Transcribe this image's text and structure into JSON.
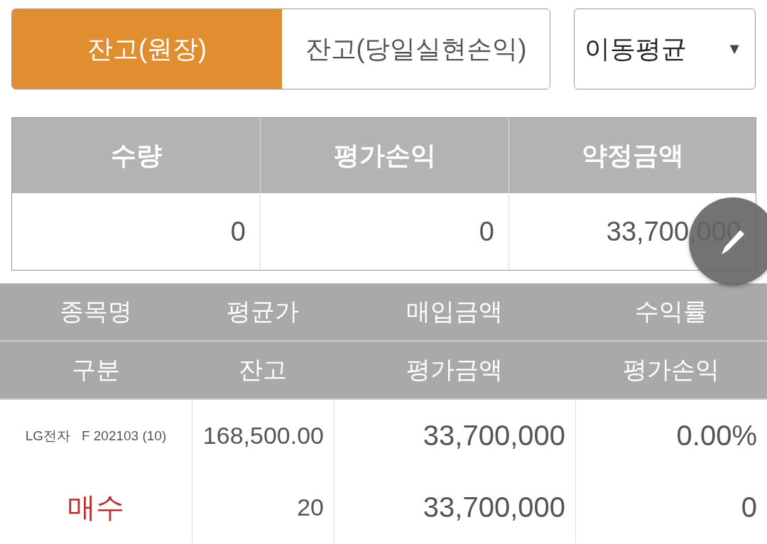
{
  "tabs": [
    {
      "label": "잔고(원장)",
      "selected": true
    },
    {
      "label": "잔고(당일실현손익)",
      "selected": false
    }
  ],
  "dropdown": {
    "value": "이동평균",
    "arrow": "▼"
  },
  "summary": {
    "columns": [
      "수량",
      "평가손익",
      "약정금액"
    ],
    "values": [
      "0",
      "0",
      "33,700,000"
    ]
  },
  "positions": {
    "header_rows": [
      [
        "종목명",
        "평균가",
        "매입금액",
        "수익률"
      ],
      [
        "구분",
        "잔고",
        "평가금액",
        "평가손익"
      ]
    ],
    "rows": [
      {
        "name": "LG전자   F 202103 (10)",
        "side": "매수",
        "kind": "buy",
        "avg_price": "168,500.00",
        "balance": "20",
        "purchase_amount": "33,700,000",
        "eval_amount": "33,700,000",
        "return_rate": "0.00%",
        "eval_pl": "0"
      }
    ]
  }
}
